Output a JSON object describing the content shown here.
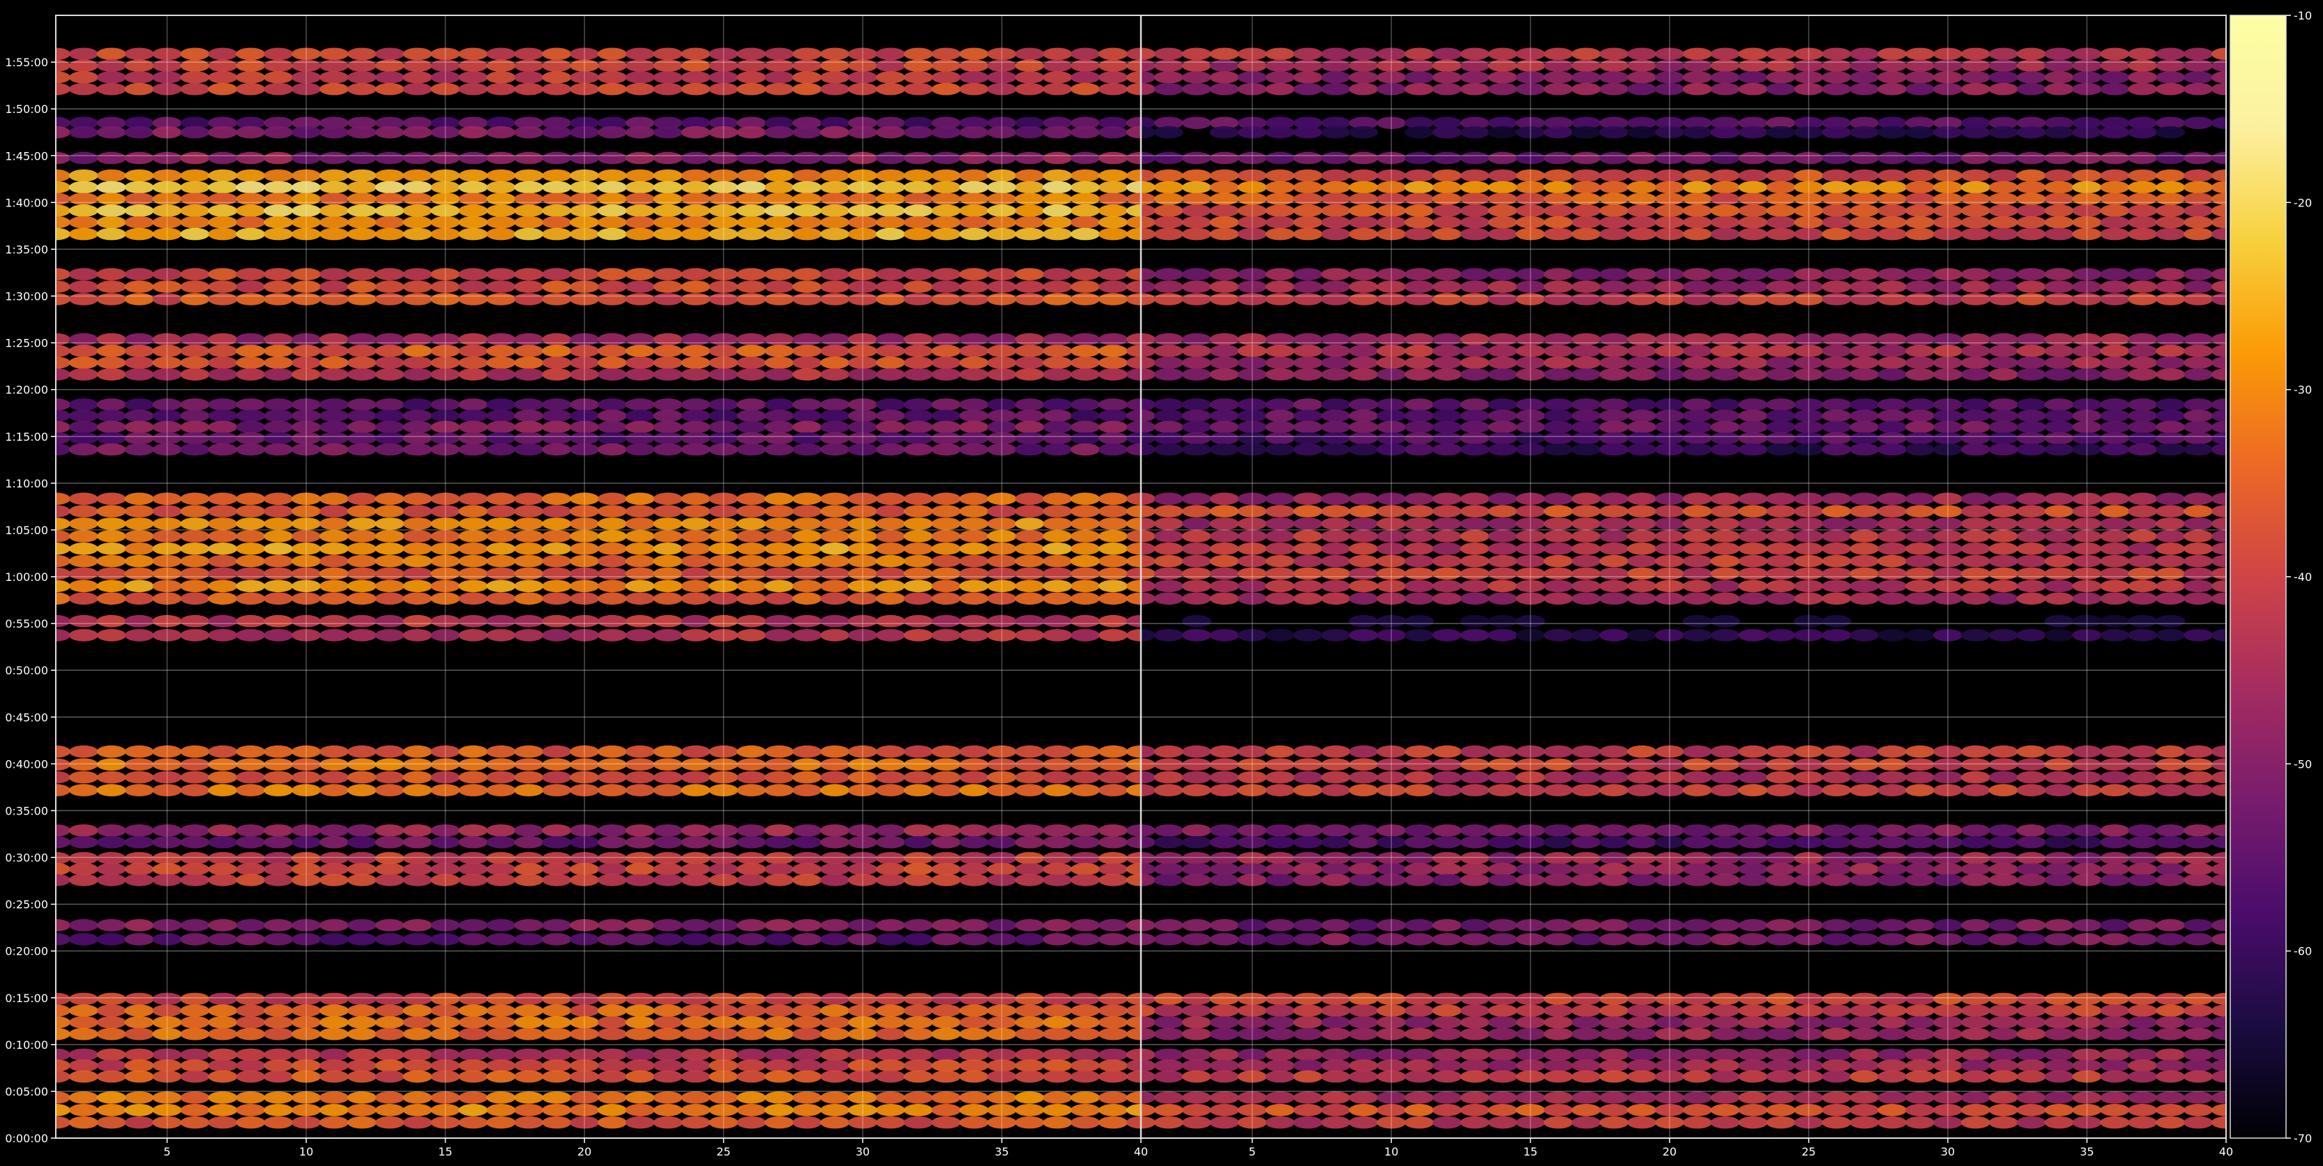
{
  "chart_data": {
    "type": "heatmap",
    "title": "",
    "xlabel": "",
    "ylabel": "",
    "panels": [
      {
        "x_range": [
          1,
          40
        ],
        "x_ticks": [
          5,
          10,
          15,
          20,
          25,
          30,
          35,
          40
        ]
      },
      {
        "x_range": [
          1,
          40
        ],
        "x_ticks": [
          5,
          10,
          15,
          20,
          25,
          30,
          35,
          40
        ]
      }
    ],
    "y_range_seconds": [
      0,
      7200
    ],
    "y_ticks": [
      "0:00:00",
      "0:05:00",
      "0:10:00",
      "0:15:00",
      "0:20:00",
      "0:25:00",
      "0:30:00",
      "0:35:00",
      "0:40:00",
      "0:45:00",
      "0:50:00",
      "0:55:00",
      "1:00:00",
      "1:05:00",
      "1:10:00",
      "1:15:00",
      "1:20:00",
      "1:25:00",
      "1:30:00",
      "1:35:00",
      "1:40:00",
      "1:45:00",
      "1:50:00",
      "1:55:00"
    ],
    "grid": true,
    "colormap": "inferno",
    "colorbar": {
      "range": [
        -70,
        -10
      ],
      "ticks": [
        "-10",
        "-20",
        "-30",
        "-40",
        "-50",
        "-60",
        "-70"
      ]
    },
    "bands": [
      {
        "start": "0:01:00",
        "end": "0:05:00",
        "level_a": -34,
        "level_b": -40
      },
      {
        "start": "0:06:00",
        "end": "0:09:30",
        "level_a": -40,
        "level_b": -45
      },
      {
        "start": "0:10:30",
        "end": "0:15:30",
        "level_a": -38,
        "level_b": -43
      },
      {
        "start": "0:20:30",
        "end": "0:23:30",
        "level_a": -52,
        "level_b": -53
      },
      {
        "start": "0:27:00",
        "end": "0:30:30",
        "level_a": -43,
        "level_b": -48
      },
      {
        "start": "0:31:00",
        "end": "0:33:30",
        "level_a": -50,
        "level_b": -53
      },
      {
        "start": "0:36:30",
        "end": "0:42:00",
        "level_a": -36,
        "level_b": -45
      },
      {
        "start": "0:53:00",
        "end": "0:56:00",
        "level_a": -45,
        "level_b": -62
      },
      {
        "start": "0:57:00",
        "end": "1:09:00",
        "level_a": -33,
        "level_b": -42
      },
      {
        "start": "1:13:00",
        "end": "1:19:00",
        "level_a": -52,
        "level_b": -55
      },
      {
        "start": "1:21:00",
        "end": "1:26:00",
        "level_a": -41,
        "level_b": -45
      },
      {
        "start": "1:29:00",
        "end": "1:33:00",
        "level_a": -41,
        "level_b": -46
      },
      {
        "start": "1:36:00",
        "end": "1:43:30",
        "level_a": -27,
        "level_b": -35
      },
      {
        "start": "1:44:00",
        "end": "1:45:30",
        "level_a": -48,
        "level_b": -55
      },
      {
        "start": "1:47:00",
        "end": "1:49:00",
        "level_a": -52,
        "level_b": -57
      },
      {
        "start": "1:51:30",
        "end": "1:56:30",
        "level_a": -39,
        "level_b": -45
      }
    ]
  }
}
